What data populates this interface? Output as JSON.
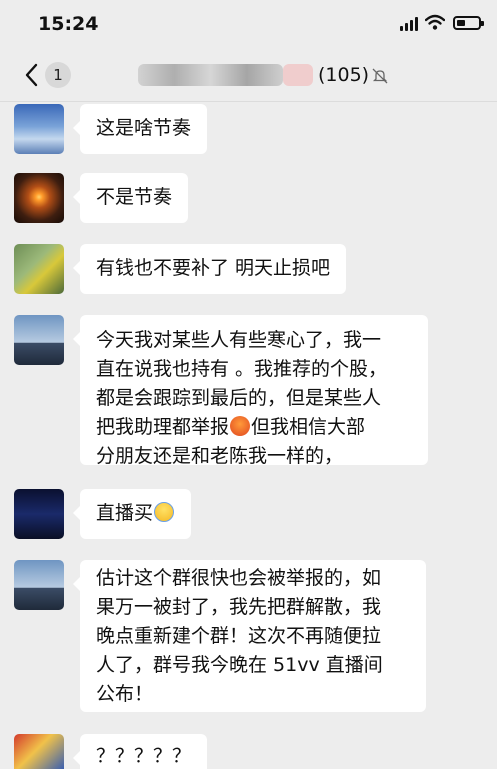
{
  "status_bar": {
    "time": "15:24"
  },
  "nav": {
    "back_badge": "1",
    "member_count": "(105)"
  },
  "messages": [
    {
      "text": "这是啥节奏"
    },
    {
      "text": "不是节奏"
    },
    {
      "text": "有钱也不要补了 明天止损吧"
    },
    {
      "lines": [
        "今天我对某些人有些寒心了，我一",
        "直在说我也持有 。我推荐的个股，",
        "都是会跟踪到最后的，但是某些人",
        "把我助理都举报",
        "但我相信大部",
        "分朋友还是和老陈我一样的，"
      ]
    },
    {
      "text": "直播买"
    },
    {
      "lines": [
        "估计这个群很快也会被举报的，如",
        "果万一被封了，我先把群解散，我",
        "晚点重新建个群！这次不再随便拉",
        "人了，群号我今晚在 51vv 直播间",
        "公布！"
      ]
    },
    {
      "text": "？？？？？"
    }
  ],
  "colors": {
    "background": "#ededed",
    "bubble": "#ffffff",
    "text": "#111111"
  },
  "icons": [
    "signal-icon",
    "wifi-icon",
    "battery-icon",
    "back-chevron-icon",
    "mute-bell-icon",
    "angry-emoji-icon",
    "scream-emoji-icon"
  ]
}
